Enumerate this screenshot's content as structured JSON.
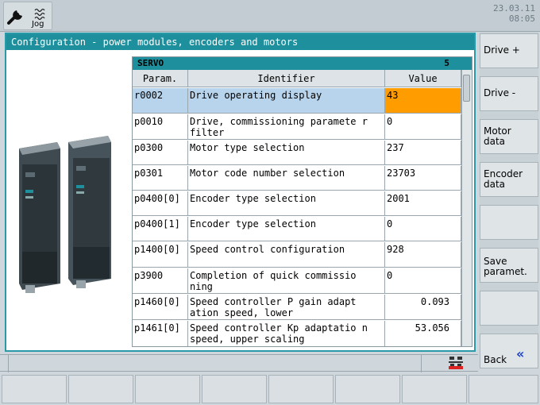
{
  "topbar": {
    "mode_label": "Jog",
    "date": "23.03.11",
    "time": "08:05"
  },
  "window": {
    "title": "Configuration - power modules, encoders and motors"
  },
  "table": {
    "drive_name": "SERVO",
    "drive_number": "5",
    "headers": {
      "param": "Param.",
      "identifier": "Identifier",
      "value": "Value"
    },
    "rows": [
      {
        "param": "r0002",
        "identifier": "Drive operating display",
        "value": "43",
        "selected": true
      },
      {
        "param": "p0010",
        "identifier": "Drive, commissioning paramete r filter",
        "value": "0"
      },
      {
        "param": "p0300",
        "identifier": "Motor type selection",
        "value": "237"
      },
      {
        "param": "p0301",
        "identifier": "Motor code number selection",
        "value": "23703"
      },
      {
        "param": "p0400[0]",
        "identifier": "Encoder type selection",
        "value": "2001"
      },
      {
        "param": "p0400[1]",
        "identifier": "Encoder type selection",
        "value": "0"
      },
      {
        "param": "p1400[0]",
        "identifier": "Speed control configuration",
        "value": "928"
      },
      {
        "param": "p3900",
        "identifier": "Completion of quick commissio ning",
        "value": "0"
      },
      {
        "param": "p1460[0]",
        "identifier": "Speed controller P gain adapt ation speed, lower",
        "value": "0.093"
      },
      {
        "param": "p1461[0]",
        "identifier": "Speed controller Kp adaptatio n speed, upper scaling",
        "value": "53.056"
      }
    ]
  },
  "softkeys_right": {
    "drive_plus": "Drive +",
    "drive_minus": "Drive -",
    "motor_data_1": "Motor",
    "motor_data_2": "data",
    "encoder_data_1": "Encoder",
    "encoder_data_2": "data",
    "save_1": "Save",
    "save_2": "paramet.",
    "back": "Back"
  },
  "icons": {
    "wrench": "wrench-icon",
    "jog": "jog-icon",
    "rcs": "rcs-network-icon",
    "back": "double-chevron-left-icon"
  },
  "colors": {
    "title_bar": "#1e8f9c",
    "selected_row": "#b8d4ec",
    "selected_value": "#ff9c00",
    "back_chevron": "#1b40c8"
  }
}
